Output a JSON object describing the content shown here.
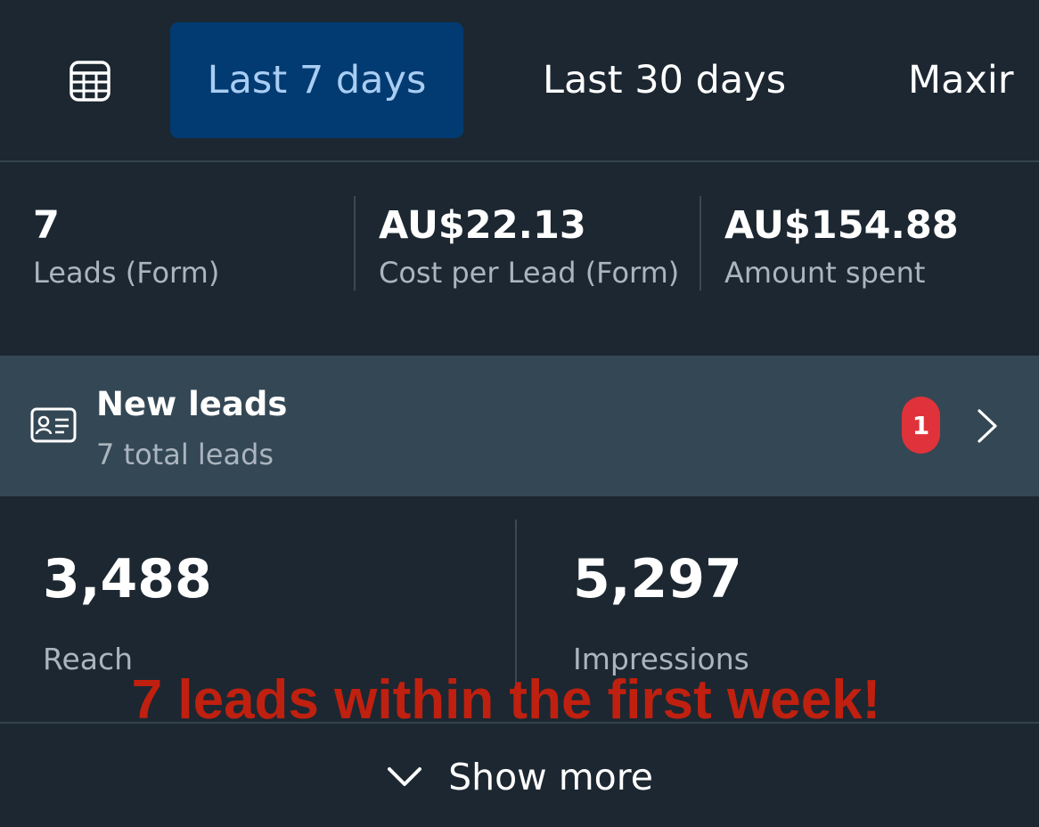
{
  "date_range": {
    "calendar_icon": "table-calendar-icon",
    "tabs": [
      {
        "label": "Last 7 days",
        "selected": true
      },
      {
        "label": "Last 30 days",
        "selected": false
      },
      {
        "label": "Maxir",
        "selected": false
      }
    ]
  },
  "summary": [
    {
      "value": "7",
      "label": "Leads (Form)"
    },
    {
      "value": "AU$22.13",
      "label": "Cost per Lead (Form)"
    },
    {
      "value": "AU$154.88",
      "label": "Amount spent"
    }
  ],
  "new_leads": {
    "icon": "contact-card-icon",
    "title": "New leads",
    "subtitle": "7 total leads",
    "badge": "1",
    "chevron_icon": "chevron-right-icon"
  },
  "stats": [
    {
      "value": "3,488",
      "label": "Reach"
    },
    {
      "value": "5,297",
      "label": "Impressions"
    }
  ],
  "caption": "7 leads within the first week!",
  "show_more": {
    "icon": "chevron-down-icon",
    "label": "Show more"
  },
  "colors": {
    "background": "#1c2731",
    "selected_tab": "#023b72",
    "selected_tab_text": "#a9cdf3",
    "leads_row": "#344754",
    "badge": "#e0323a",
    "caption": "#c0200f"
  }
}
